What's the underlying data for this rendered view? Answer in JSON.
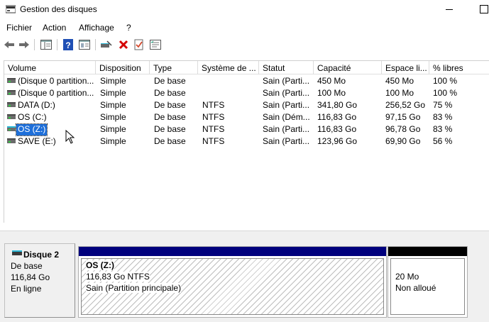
{
  "window": {
    "title": "Gestion des disques"
  },
  "menu": [
    "Fichier",
    "Action",
    "Affichage",
    "?"
  ],
  "toolbar": [
    {
      "icon": "back-arrow-icon"
    },
    {
      "icon": "forward-arrow-icon"
    },
    {
      "icon": "console-tree-icon"
    },
    {
      "icon": "help-icon"
    },
    {
      "icon": "properties-pane-icon"
    },
    {
      "icon": "connect-disk-icon"
    },
    {
      "icon": "delete-icon",
      "color": "#d40000"
    },
    {
      "icon": "checklist-icon"
    },
    {
      "icon": "properties-icon"
    }
  ],
  "volumes": {
    "columns": [
      "Volume",
      "Disposition",
      "Type",
      "Système de ...",
      "Statut",
      "Capacité",
      "Espace li...",
      "% libres"
    ],
    "rows": [
      {
        "volume": "(Disque 0 partition...",
        "layout": "Simple",
        "type": "De base",
        "fs": "",
        "status": "Sain (Parti...",
        "capacity": "450 Mo",
        "free": "450 Mo",
        "pct": "100 %"
      },
      {
        "volume": "(Disque 0 partition...",
        "layout": "Simple",
        "type": "De base",
        "fs": "",
        "status": "Sain (Parti...",
        "capacity": "100 Mo",
        "free": "100 Mo",
        "pct": "100 %"
      },
      {
        "volume": "DATA (D:)",
        "layout": "Simple",
        "type": "De base",
        "fs": "NTFS",
        "status": "Sain (Parti...",
        "capacity": "341,80 Go",
        "free": "256,52 Go",
        "pct": "75 %"
      },
      {
        "volume": "OS (C:)",
        "layout": "Simple",
        "type": "De base",
        "fs": "NTFS",
        "status": "Sain (Dém...",
        "capacity": "116,83 Go",
        "free": "97,15 Go",
        "pct": "83 %"
      },
      {
        "volume": "OS (Z:)",
        "layout": "Simple",
        "type": "De base",
        "fs": "NTFS",
        "status": "Sain (Parti...",
        "capacity": "116,83 Go",
        "free": "96,78 Go",
        "pct": "83 %",
        "selected": true
      },
      {
        "volume": "SAVE (E:)",
        "layout": "Simple",
        "type": "De base",
        "fs": "NTFS",
        "status": "Sain (Parti...",
        "capacity": "123,96 Go",
        "free": "69,90 Go",
        "pct": "56 %"
      }
    ]
  },
  "disk": {
    "name": "Disque 2",
    "type": "De base",
    "size": "116,84 Go",
    "state": "En ligne",
    "partitions": {
      "primary": {
        "name": "OS  (Z:)",
        "size": "116,83 Go NTFS",
        "status": "Sain (Partition principale)",
        "header_color": "#00007d"
      },
      "unallocated": {
        "size": "20 Mo",
        "status": "Non alloué",
        "header_color": "#000000"
      }
    }
  }
}
